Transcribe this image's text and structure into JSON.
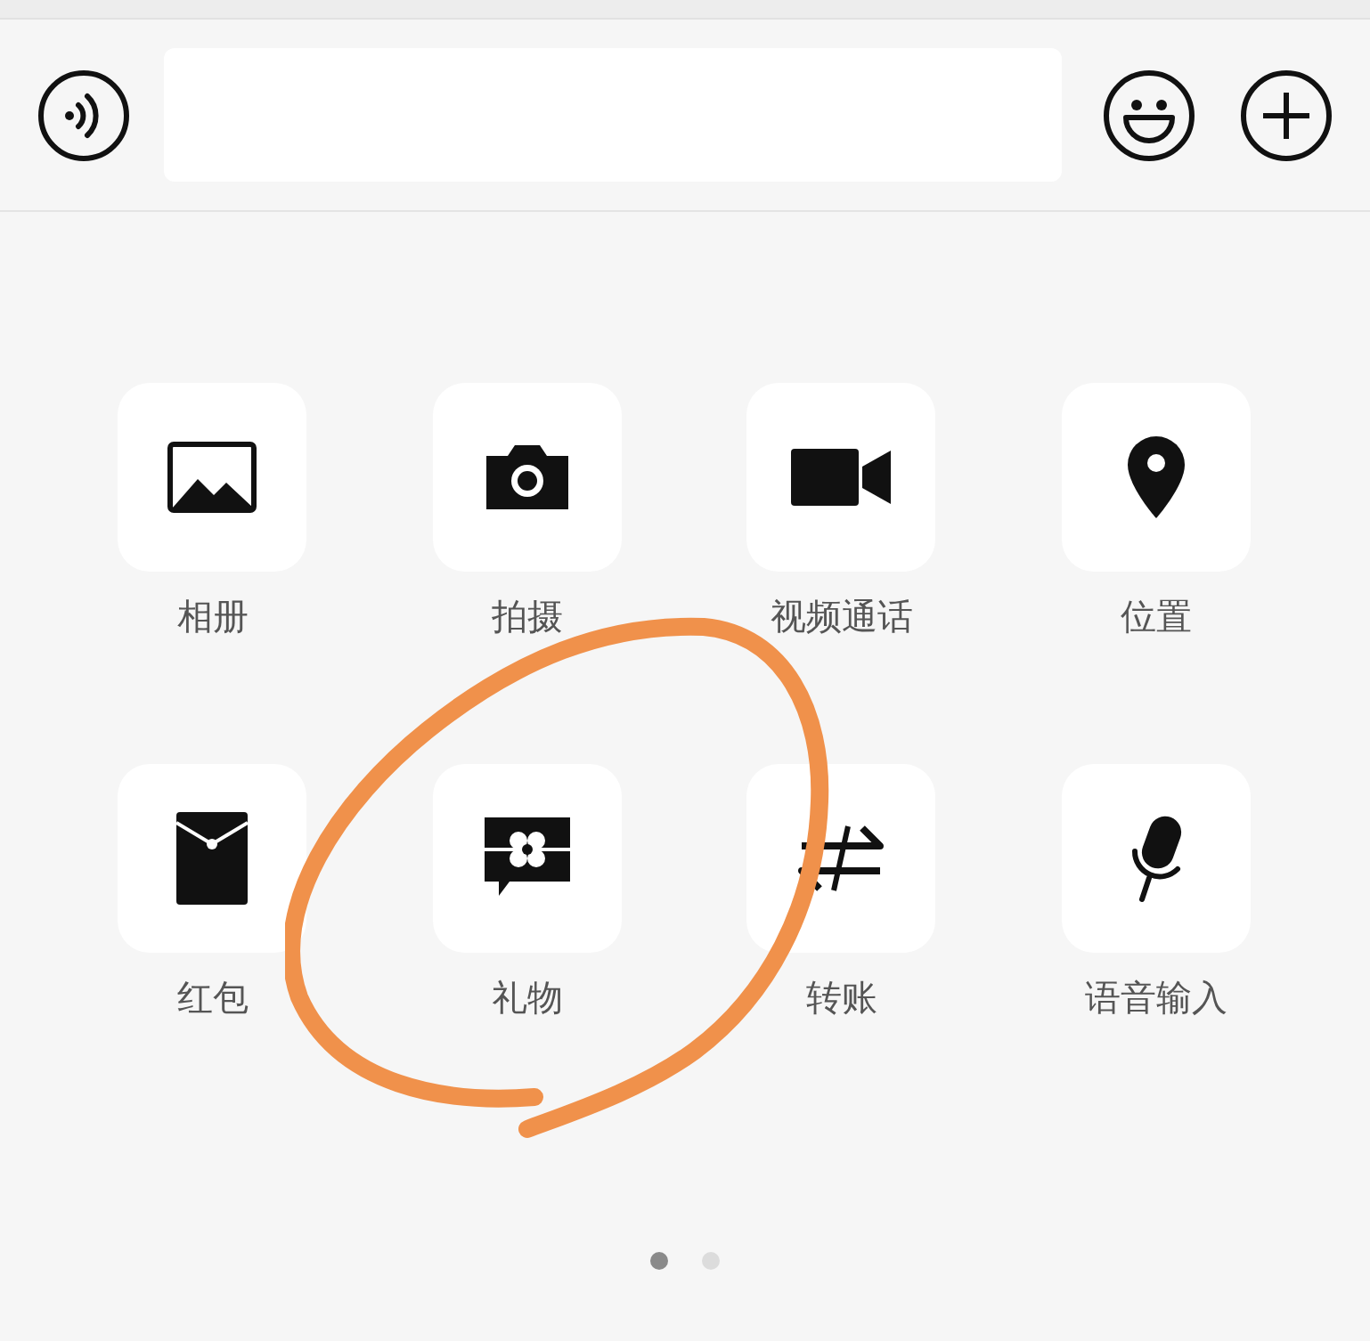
{
  "actions": [
    {
      "label": "相册"
    },
    {
      "label": "拍摄"
    },
    {
      "label": "视频通话"
    },
    {
      "label": "位置"
    },
    {
      "label": "红包"
    },
    {
      "label": "礼物"
    },
    {
      "label": "转账"
    },
    {
      "label": "语音输入"
    }
  ],
  "pages": [
    {
      "selected": true
    },
    {
      "selected": false
    }
  ]
}
